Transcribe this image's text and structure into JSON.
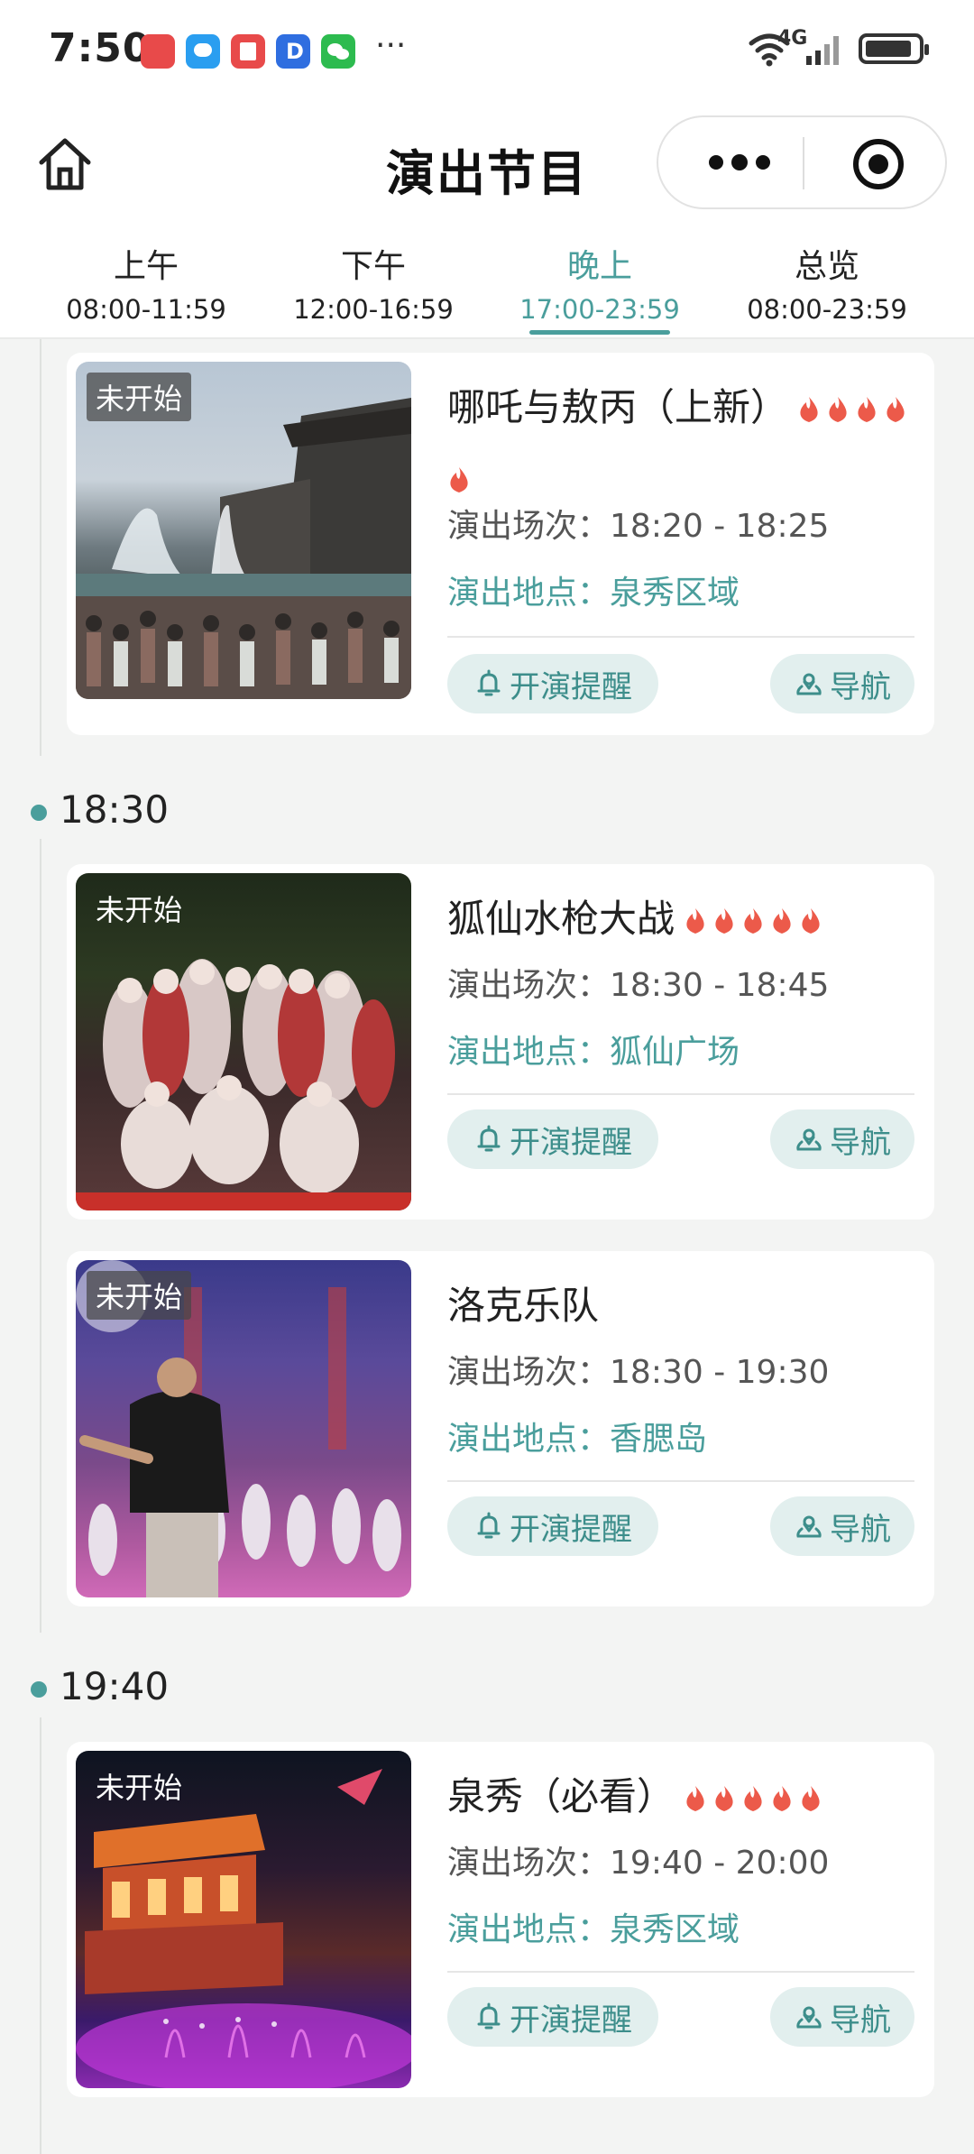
{
  "status_bar": {
    "time": "7:50",
    "network": "4G",
    "more": "···",
    "app_icons": [
      {
        "name": "huawei-appgallery-icon",
        "color": "#e84a4a"
      },
      {
        "name": "messages-icon",
        "color": "#2a9ef0"
      },
      {
        "name": "books-icon",
        "color": "#e84a4a"
      },
      {
        "name": "dingtalk-icon",
        "color": "#2f6ee0"
      },
      {
        "name": "wechat-icon",
        "color": "#2dbb4f"
      }
    ]
  },
  "header": {
    "title": "演出节目"
  },
  "tabs": [
    {
      "label": "上午",
      "time": "08:00-11:59",
      "active": false
    },
    {
      "label": "下午",
      "time": "12:00-16:59",
      "active": false
    },
    {
      "label": "晚上",
      "time": "17:00-23:59",
      "active": true
    },
    {
      "label": "总览",
      "time": "08:00-23:59",
      "active": false
    }
  ],
  "groups": [
    {
      "time": "18:30"
    },
    {
      "time": "19:40"
    }
  ],
  "labels": {
    "session_prefix": "演出场次：",
    "place_prefix": "演出地点：",
    "remind_button": "开演提醒",
    "nav_button": "导航"
  },
  "shows": [
    {
      "status": "未开始",
      "title": "哪吒与敖丙（上新）",
      "hot": 5,
      "session": "18:20 - 18:25",
      "place": "泉秀区域"
    },
    {
      "status": "未开始",
      "title": "狐仙水枪大战",
      "hot": 5,
      "session": "18:30 - 18:45",
      "place": "狐仙广场"
    },
    {
      "status": "未开始",
      "title": "洛克乐队",
      "hot": 0,
      "session": "18:30 - 19:30",
      "place": "香腮岛"
    },
    {
      "status": "未开始",
      "title": "泉秀（必看）",
      "hot": 5,
      "session": "19:40 - 20:00",
      "place": "泉秀区域"
    }
  ],
  "colors": {
    "accent": "#4a9e9c",
    "pill_bg": "#e2efee",
    "flame": "#ec5a4a",
    "background": "#f3f4f3"
  }
}
